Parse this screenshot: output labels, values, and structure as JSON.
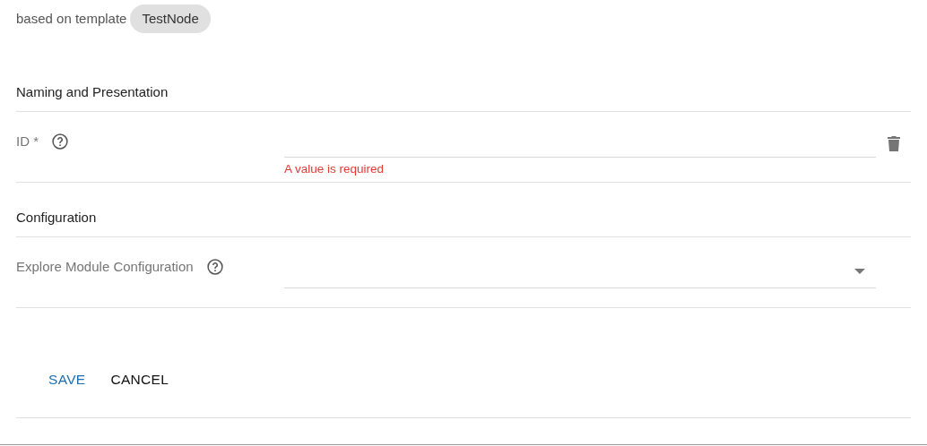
{
  "template": {
    "label": "based on template",
    "chip": "TestNode"
  },
  "sections": [
    {
      "title": "Naming and Presentation",
      "fields": [
        {
          "kind": "text",
          "label": "ID *",
          "error": "A value is required",
          "deletable": true
        }
      ]
    },
    {
      "title": "Configuration",
      "fields": [
        {
          "kind": "select",
          "label": "Explore Module Configuration",
          "deletable": false
        }
      ]
    }
  ],
  "buttons": [
    {
      "label": "SAVE",
      "kind": "primary"
    },
    {
      "label": "CANCEL",
      "kind": "default"
    }
  ]
}
